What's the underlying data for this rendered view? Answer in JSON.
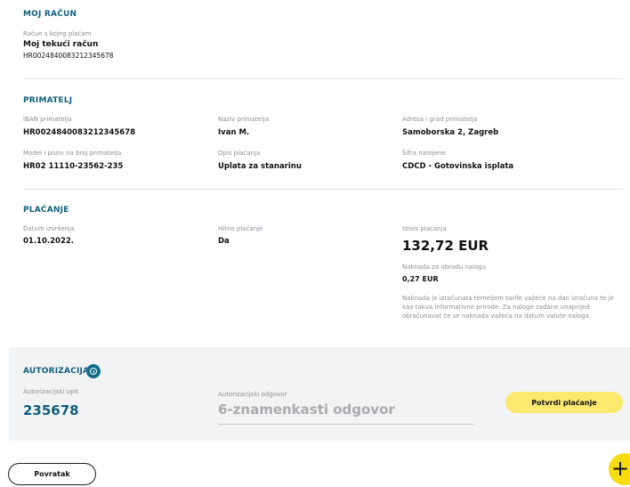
{
  "account": {
    "title": "MOJ RAČUN",
    "from_label": "Račun s kojeg plaćam",
    "name": "Moj tekući račun",
    "iban": "HR0024840083212345678"
  },
  "recipient": {
    "title": "PRIMATELJ",
    "iban_label": "IBAN primatelja",
    "iban": "HR0024840083212345678",
    "name_label": "Naziv primatelja",
    "name": "Ivan M.",
    "address_label": "Adresa i grad primatelja",
    "address": "Samoborska 2, Zagreb",
    "model_label": "Model i poziv na broj primatelja",
    "model": "HR02 11110-23562-235",
    "desc_label": "Opis plaćanja",
    "desc": "Uplata za stanarinu",
    "purpose_label": "Šifra namjene",
    "purpose": "CDCD - Gotovinska isplata"
  },
  "payment": {
    "title": "PLAĆANJE",
    "date_label": "Datum izvršenja",
    "date": "01.10.2022.",
    "urgent_label": "Hitno plaćanje",
    "urgent": "Da",
    "amount_label": "Iznos plaćanja",
    "amount": "132,72 EUR",
    "fee_label": "Naknada za obradu naloga",
    "fee": "0,27 EUR",
    "note": "Naknada je izračunata temeljem tarife važeće na dan izračuna te je kao takva informativne prirode. Za naloge zadane unaprijed obračunavat će se naknada važeća na datum valute naloga."
  },
  "authorization": {
    "title": "AUTORIZACIJA",
    "request_label": "Autorizacijski upit",
    "request_code": "235678",
    "response_label": "Autorizacijski odgovor",
    "response_placeholder": "6-znamenkasti odgovor",
    "confirm_label": "Potvrdi plaćanje"
  },
  "footer": {
    "back_label": "Povratak"
  },
  "colors": {
    "accent": "#0f5f7a",
    "button_yellow": "#fbe96f",
    "fab_yellow": "#f7dc11",
    "band_gray": "#f2f3f4"
  },
  "icons": {
    "info": "info-icon",
    "fab": "plus-icon"
  }
}
